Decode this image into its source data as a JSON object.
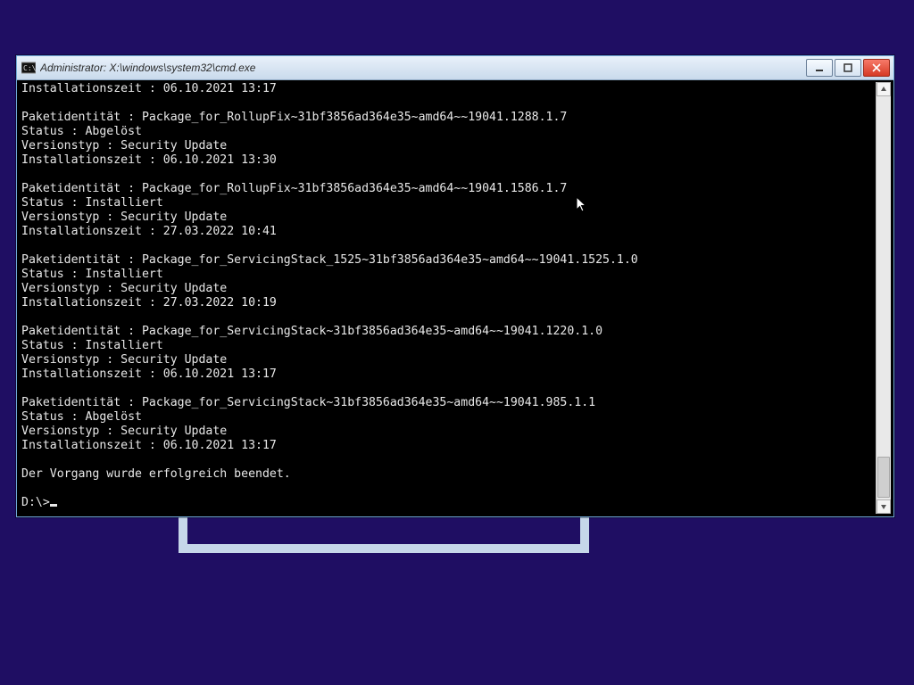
{
  "window": {
    "title": "Administrator: X:\\windows\\system32\\cmd.exe"
  },
  "terminal": {
    "line_top": "Installationszeit : 06.10.2021 13:17",
    "packages": [
      {
        "ident": "Paketidentität : Package_for_RollupFix~31bf3856ad364e35~amd64~~19041.1288.1.7",
        "status": "Status : Abgelöst",
        "vtype": "Versionstyp : Security Update",
        "itime": "Installationszeit : 06.10.2021 13:30"
      },
      {
        "ident": "Paketidentität : Package_for_RollupFix~31bf3856ad364e35~amd64~~19041.1586.1.7",
        "status": "Status : Installiert",
        "vtype": "Versionstyp : Security Update",
        "itime": "Installationszeit : 27.03.2022 10:41"
      },
      {
        "ident": "Paketidentität : Package_for_ServicingStack_1525~31bf3856ad364e35~amd64~~19041.1525.1.0",
        "status": "Status : Installiert",
        "vtype": "Versionstyp : Security Update",
        "itime": "Installationszeit : 27.03.2022 10:19"
      },
      {
        "ident": "Paketidentität : Package_for_ServicingStack~31bf3856ad364e35~amd64~~19041.1220.1.0",
        "status": "Status : Installiert",
        "vtype": "Versionstyp : Security Update",
        "itime": "Installationszeit : 06.10.2021 13:17"
      },
      {
        "ident": "Paketidentität : Package_for_ServicingStack~31bf3856ad364e35~amd64~~19041.985.1.1",
        "status": "Status : Abgelöst",
        "vtype": "Versionstyp : Security Update",
        "itime": "Installationszeit : 06.10.2021 13:17"
      }
    ],
    "done": "Der Vorgang wurde erfolgreich beendet.",
    "prompt": "D:\\>"
  }
}
